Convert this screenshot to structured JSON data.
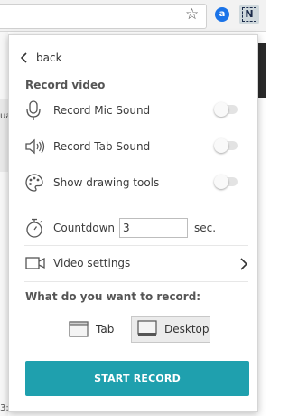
{
  "browser": {
    "extension_a_label": "a",
    "extension_n_label": "N",
    "page_fragment_left": "ua",
    "page_fragment_bottom": "3:"
  },
  "popup": {
    "back_label": "back",
    "record_video_title": "Record video",
    "options": [
      {
        "label": "Record Mic Sound",
        "icon": "microphone-icon",
        "enabled": false
      },
      {
        "label": "Record Tab Sound",
        "icon": "speaker-icon",
        "enabled": false
      },
      {
        "label": "Show drawing tools",
        "icon": "palette-icon",
        "enabled": false
      }
    ],
    "countdown": {
      "label": "Countdown",
      "value": "3",
      "unit": "sec."
    },
    "video_settings_label": "Video settings",
    "record_target_title": "What do you want to record:",
    "targets": [
      {
        "label": "Tab",
        "selected": false
      },
      {
        "label": "Desktop",
        "selected": true
      }
    ],
    "start_button_label": "START RECORD"
  },
  "colors": {
    "accent": "#1fa0ae",
    "toggle_off_track": "#e3e3e3",
    "selected_target_bg": "#ebebeb"
  }
}
